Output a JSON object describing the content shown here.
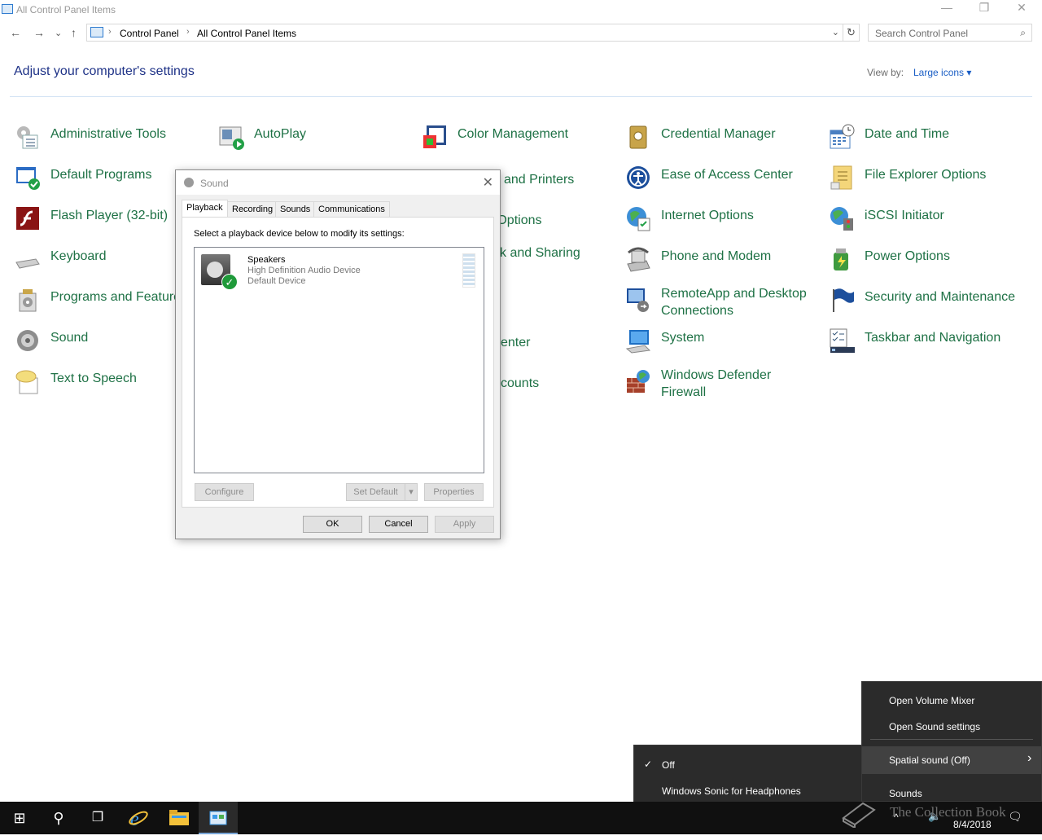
{
  "window": {
    "title": "All Control Panel Items",
    "minimize_glyph": "—",
    "restore_glyph": "❐",
    "close_glyph": "✕"
  },
  "nav": {
    "back": "←",
    "forward": "→",
    "recent": "⌄",
    "up": "↑"
  },
  "address": {
    "crumbs": [
      "Control Panel",
      "All Control Panel Items"
    ],
    "separator": "›",
    "dropdown": "⌄",
    "refresh": "↻"
  },
  "search": {
    "placeholder": "Search Control Panel",
    "icon": "⌕"
  },
  "main": {
    "heading": "Adjust your computer's settings",
    "view_by_label": "View by:",
    "view_by_value": "Large icons ▾"
  },
  "items": {
    "administrative_tools": "Administrative Tools",
    "autoplay": "AutoPlay",
    "color_management": "Color Management",
    "credential_manager": "Credential Manager",
    "date_and_time": "Date and Time",
    "default_programs": "Default Programs",
    "devices_and_printers_partial": "and Printers",
    "ease_of_access": "Ease of Access Center",
    "file_explorer_options": "File Explorer Options",
    "flash_player": "Flash Player (32-bit)",
    "indexing_options_partial": "g Options",
    "internet_options": "Internet Options",
    "iscsi_initiator": "iSCSI Initiator",
    "keyboard": "Keyboard",
    "network_sharing_partial": "k and Sharing",
    "phone_and_modem": "Phone and Modem",
    "power_options": "Power Options",
    "programs_and_features": "Programs and Feature",
    "remoteapp_line1": "RemoteApp and Desktop",
    "remoteapp_line2": "Connections",
    "security_and_maintenance": "Security and Maintenance",
    "sound": "Sound",
    "sync_center_partial": "enter",
    "system": "System",
    "taskbar_and_navigation": "Taskbar and Navigation",
    "text_to_speech": "Text to Speech",
    "user_accounts_partial": "counts",
    "defender_line1": "Windows Defender",
    "defender_line2": "Firewall"
  },
  "dialog": {
    "title": "Sound",
    "close": "✕",
    "tabs": [
      "Playback",
      "Recording",
      "Sounds",
      "Communications"
    ],
    "instruction": "Select a playback device below to modify its settings:",
    "device": {
      "name": "Speakers",
      "description": "High Definition Audio Device",
      "status": "Default Device",
      "check": "✓"
    },
    "configure": "Configure",
    "set_default": "Set Default",
    "set_default_arrow": "▾",
    "properties": "Properties",
    "ok": "OK",
    "cancel": "Cancel",
    "apply": "Apply"
  },
  "context_menu": {
    "items": [
      "Open Volume Mixer",
      "Open Sound settings",
      "Spatial sound (Off)",
      "Sounds"
    ],
    "submenu_arrow": "›"
  },
  "submenu": {
    "items": [
      "Off",
      "Windows Sonic for Headphones"
    ],
    "check": "✓"
  },
  "taskbar": {
    "start": "⊞",
    "search": "⚲",
    "task_view": "❐",
    "date": "8/4/2018",
    "tray_arrow": "^",
    "volume": "🔈",
    "notifications": "🗨"
  },
  "watermark": "The Collection Book",
  "colors": {
    "link_green": "#1e7145",
    "heading_blue": "#1e3287",
    "menu_bg": "#2b2b2b"
  }
}
